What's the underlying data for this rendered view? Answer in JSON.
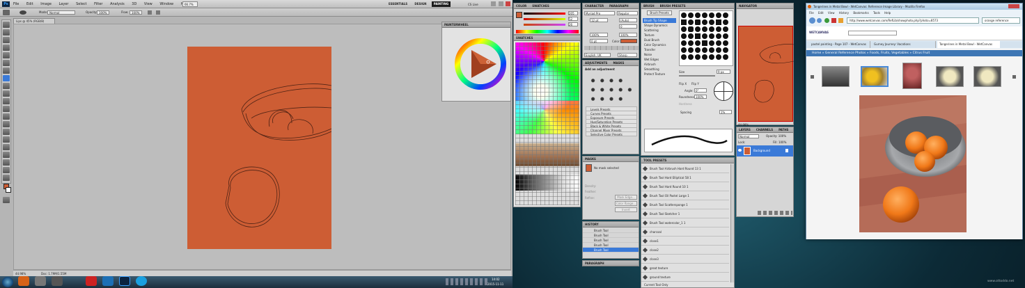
{
  "photoshop": {
    "logo": "Ps",
    "menu": [
      "File",
      "Edit",
      "Image",
      "Layer",
      "Select",
      "Filter",
      "Analysis",
      "3D",
      "View",
      "Window",
      "Help"
    ],
    "zoom": "66.7%",
    "workspaces": [
      "ESSENTIALS",
      "DESIGN",
      "PAINTING"
    ],
    "active_workspace": "PAINTING",
    "cs_live": "CS Live",
    "options": {
      "mode_label": "Mode:",
      "mode_value": "Normal",
      "opacity_label": "Opacity:",
      "opacity_value": "100%",
      "flow_label": "Flow:",
      "flow_value": "100%"
    },
    "doc_tab": "Lips @ 45% (RGB/8)",
    "status_zoom": "44.98%",
    "status_doc": "Doc: 1.79M/1.55M",
    "canvas_color": "#cd5d34",
    "panel_painterwheel": "PAINTERWHEEL"
  },
  "panels": {
    "color": {
      "tabs": [
        "COLOR",
        "SWATCHES"
      ],
      "values": [
        "205",
        "52",
        "26"
      ]
    },
    "swatches_title": "SWATCHES",
    "character": {
      "tabs": [
        "CHARACTER",
        "PARAGRAPH"
      ],
      "font": "Myriad Pro",
      "style": "Regular",
      "size": "12 pt",
      "leading": "(Auto)",
      "tracking": "0",
      "scale_v": "100%",
      "scale_h": "100%",
      "baseline": "0 pt",
      "color_label": "Color:",
      "language": "English: UK",
      "aa": "Sharp"
    },
    "adjustments": {
      "tabs": [
        "ADJUSTMENTS",
        "MASKS"
      ],
      "heading": "Add an adjustment",
      "presets": [
        "Levels Presets",
        "Curves Presets",
        "Exposure Presets",
        "Hue/Saturation Presets",
        "Black & White Presets",
        "Channel Mixer Presets",
        "Selective Color Presets"
      ]
    },
    "masks": {
      "tabs": [
        "MASKS"
      ],
      "msg": "No mask selected",
      "density_label": "Density:",
      "feather_label": "Feather:",
      "refine_label": "Refine:",
      "buttons": [
        "Mask Edge...",
        "Color Range...",
        "Invert"
      ]
    },
    "history": {
      "tabs": [
        "HISTORY"
      ],
      "items": [
        "Brush Tool",
        "Brush Tool",
        "Brush Tool",
        "Brush Tool",
        "Brush Tool"
      ]
    },
    "paragraph_tab": "PARAGRAPH",
    "brush": {
      "tabs": [
        "BRUSH",
        "BRUSH PRESETS"
      ],
      "presets_button": "Brush Presets",
      "options": [
        "Brush Tip Shape",
        "Shape Dynamics",
        "Scattering",
        "Texture",
        "Dual Brush",
        "Color Dynamics",
        "Transfer",
        "Noise",
        "Wet Edges",
        "Airbrush",
        "Smoothing",
        "Protect Texture"
      ],
      "size_label": "Size",
      "size_value": "9 px",
      "flip_x": "Flip X",
      "flip_y": "Flip Y",
      "angle_label": "Angle:",
      "angle_value": "0°",
      "roundness_label": "Roundness:",
      "roundness_value": "100%",
      "hardness_label": "Hardness",
      "spacing_label": "Spacing",
      "spacing_value": "1%"
    },
    "tool_presets": {
      "tabs": [
        "TOOL PRESETS"
      ],
      "items": [
        "Brush Tool Airbrush Hard Round 13 1",
        "Brush Tool Hard Elliptical 58 1",
        "Brush Tool Hard Round 10 1",
        "Brush Tool Oil Pastel Large 1",
        "Brush Tool Scattersponge 1",
        "Brush Tool Sketcher 1",
        "Brush Tool watercolor_1 1",
        "charcoal",
        "close1",
        "close2",
        "close3",
        "great texture",
        "ground texture"
      ],
      "footer": "Current Tool Only"
    },
    "navigator": {
      "tabs": [
        "NAVIGATOR"
      ],
      "zoom": "44.98%"
    },
    "layers": {
      "tabs": [
        "LAYERS",
        "CHANNELS",
        "PATHS"
      ],
      "blend": "Normal",
      "opacity": "Opacity: 100%",
      "lock": "Lock:",
      "fill": "Fill: 100%",
      "layer_name": "Background"
    }
  },
  "browser": {
    "title": "Tangerines in Metal Bowl - WetCanvas: Reference Image Library - Mozilla Firefox",
    "menu": [
      "File",
      "Edit",
      "View",
      "History",
      "Bookmarks",
      "Tools",
      "Help"
    ],
    "url": "http://www.wetcanvas.com/RefLib/showphoto.php?photo=8573",
    "search_placeholder": "orange reference",
    "logo": "WETCANVAS",
    "tabs": [
      "pastel painting - Page 107 - WetCanvas",
      "Gurney Journey: Vacations",
      "Tangerines in Metal Bowl - WetCanvas"
    ],
    "breadcrumb": "Home » General Reference Photos » Foods, Fruits, Vegetables » Citrus Fruit"
  },
  "taskbar": {
    "time": "14:02",
    "date": "2015-11-11",
    "watermark": "www.ottoddo.net"
  }
}
